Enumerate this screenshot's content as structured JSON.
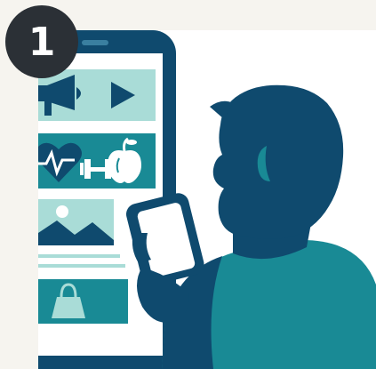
{
  "step": {
    "number": "1"
  },
  "palette": {
    "background": "#f6f4ef",
    "frame": "#ffffff",
    "badge": "#2b3036",
    "navy": "#0f4a6e",
    "teal": "#198a95",
    "light_teal": "#a9dcd7",
    "white": "#ffffff"
  },
  "illustration": {
    "icons": [
      "megaphone-icon",
      "play-icon",
      "heart-pulse-icon",
      "dumbbell-icon",
      "apple-icon",
      "landscape-image-icon",
      "shopping-bag-icon"
    ],
    "figure": "person-silhouette-holding-phone"
  }
}
